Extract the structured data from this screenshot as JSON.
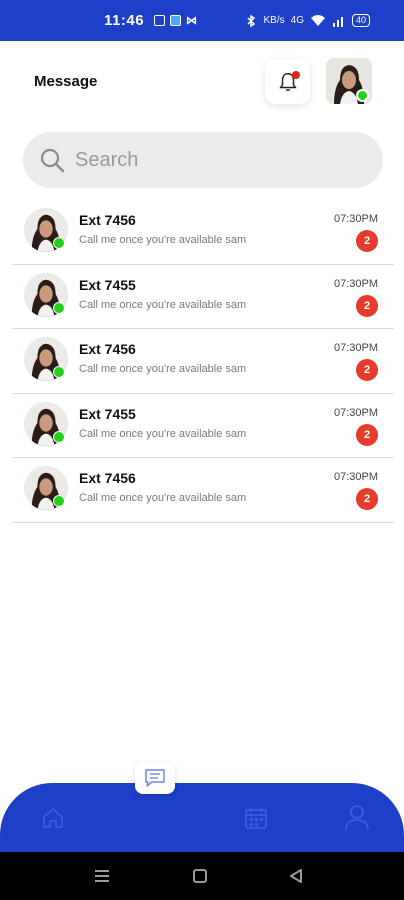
{
  "status_bar": {
    "time": "11:46",
    "signal_text": "4G",
    "speed_text": "KB/s",
    "battery": "40"
  },
  "header": {
    "title": "Message"
  },
  "search": {
    "placeholder": "Search"
  },
  "messages": [
    {
      "name": "Ext 7456",
      "preview": "Call me once you're available sam",
      "time": "07:30PM",
      "unread": "2"
    },
    {
      "name": "Ext 7455",
      "preview": "Call me once you're available sam",
      "time": "07:30PM",
      "unread": "2"
    },
    {
      "name": "Ext 7456",
      "preview": "Call me once you're available sam",
      "time": "07:30PM",
      "unread": "2"
    },
    {
      "name": "Ext 7455",
      "preview": "Call me once you're available sam",
      "time": "07:30PM",
      "unread": "2"
    },
    {
      "name": "Ext 7456",
      "preview": "Call me once you're available sam",
      "time": "07:30PM",
      "unread": "2"
    }
  ],
  "bottom_nav": {
    "items": [
      "home-icon",
      "chat-icon",
      "calendar-icon",
      "user-icon"
    ],
    "active": "chat-icon"
  },
  "colors": {
    "primary": "#1e40c8",
    "online": "#22d11c",
    "badge": "#e53b2c",
    "search_bg": "#ebebeb"
  }
}
